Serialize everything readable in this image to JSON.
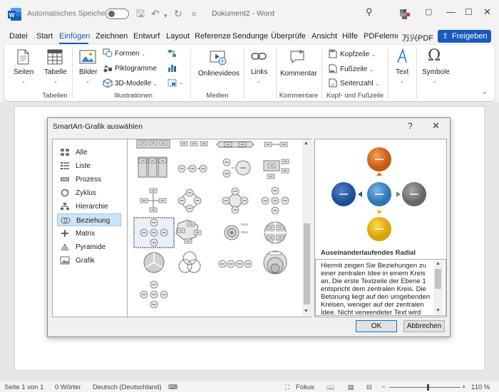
{
  "titlebar": {
    "autosave_label": "Automatisches Speichern",
    "autosave_state": "off",
    "document_title": "Dokument2 - Word",
    "icons": [
      "word-logo-icon",
      "autosave-toggle",
      "save-icon",
      "undo-icon",
      "redo-icon",
      "customize-icon",
      "search-icon",
      "avatar",
      "ribbon-display-icon",
      "minimize-icon",
      "maximize-icon",
      "close-icon"
    ]
  },
  "menu": {
    "tabs": [
      "Datei",
      "Start",
      "Einfügen",
      "Zeichnen",
      "Entwurf",
      "Layout",
      "Referenze",
      "Sendunge",
      "Überprüfe",
      "Ansicht",
      "Hilfe",
      "PDFelemer",
      "万兴PDF"
    ],
    "active_tab": "Einfügen",
    "share_label": "Freigeben",
    "accent_color": "#185abd"
  },
  "ribbon": {
    "seiten": "Seiten",
    "tabelle": "Tabelle",
    "bilder": "Bilder",
    "formen": "Formen",
    "piktogramme": "Piktogramme",
    "modelle": "3D-Modelle",
    "onlinevideos": "Onlinevideos",
    "links": "Links",
    "kommentar": "Kommentar",
    "kopfzeile": "Kopfzeile",
    "fusszeile": "Fußzeile",
    "seitenzahl": "Seitenzahl",
    "text": "Text",
    "symbole": "Symbole",
    "groups": {
      "tabellen": "Tabellen",
      "illustrationen": "Illustrationen",
      "medien": "Medien",
      "kommentare": "Kommentare",
      "kopf": "Kopf- und Fußzeile"
    }
  },
  "dialog": {
    "title": "SmartArt-Grafik auswählen",
    "help": "?",
    "close": "✕",
    "categories": [
      "Alle",
      "Liste",
      "Prozess",
      "Zyklus",
      "Hierarchie",
      "Beziehung",
      "Matrix",
      "Pyramide",
      "Grafik"
    ],
    "selected_category": "Beziehung",
    "preview_title": "Auseinanderlaufendes Radial",
    "description": "Hiermit zeigen Sie Beziehungen zu einer zentralen Idee in einem Kreis an. Die erste Textzeile der Ebene 1 entspricht dem zentralen Kreis. Die Betonung liegt auf den umgebenden Kreisen, weniger auf der zentralen Idee. Nicht verwendeter Text wird",
    "ok": "OK",
    "cancel": "Abbrechen",
    "preview_colors": {
      "top": "#e36c09",
      "left": "#1f5aa8",
      "center": "#2e86c1",
      "right": "#7f7f7f",
      "bottom": "#e8b800"
    }
  },
  "status": {
    "page": "Seite 1 von 1",
    "words": "0 Wörter",
    "language": "Deutsch (Deutschland)",
    "focus": "Fokus",
    "zoom": "110 %",
    "zoom_minus": "−",
    "zoom_plus": "+"
  }
}
